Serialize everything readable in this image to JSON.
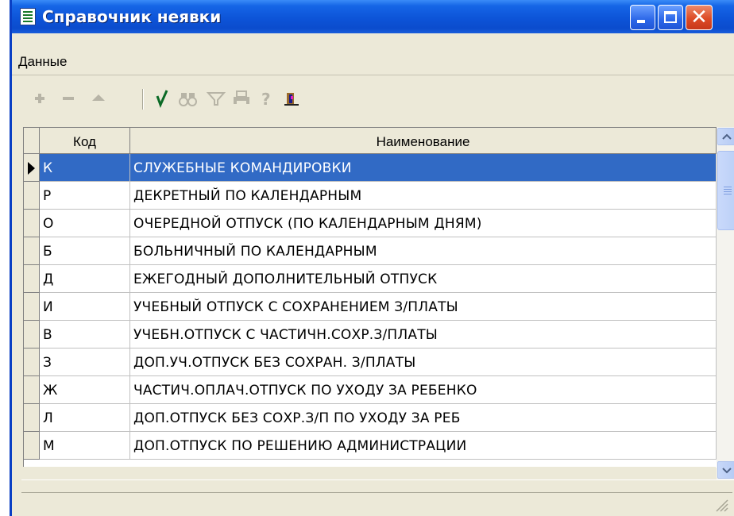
{
  "window": {
    "title": "Справочник неявки",
    "title_bar_color": "#0b4ccd",
    "controls": {
      "minimize_icon": "minimize-icon",
      "maximize_icon": "maximize-icon",
      "close_icon": "close-icon"
    }
  },
  "menu": {
    "items": [
      {
        "label": "Данные"
      }
    ]
  },
  "toolbar": {
    "buttons": [
      {
        "icon": "add-icon",
        "enabled": false
      },
      {
        "icon": "delete-icon",
        "enabled": false
      },
      {
        "icon": "move-up-icon",
        "enabled": false
      },
      {
        "icon": "check-icon",
        "enabled": true
      },
      {
        "icon": "find-icon",
        "enabled": false
      },
      {
        "icon": "filter-icon",
        "enabled": false
      },
      {
        "icon": "print-icon",
        "enabled": false
      },
      {
        "icon": "help-icon",
        "enabled": false
      },
      {
        "icon": "exit-icon",
        "enabled": true
      }
    ]
  },
  "grid": {
    "columns": [
      {
        "header": "Код"
      },
      {
        "header": "Наименование"
      }
    ],
    "selected_row": 0,
    "selection_color": "#316ac5",
    "rows": [
      {
        "code": "К",
        "name": "СЛУЖЕБНЫЕ КОМАНДИРОВКИ"
      },
      {
        "code": "Р",
        "name": "ДЕКРЕТНЫЙ ПО КАЛЕНДАРНЫМ"
      },
      {
        "code": "О",
        "name": "ОЧЕРЕДНОЙ ОТПУСК (ПО КАЛЕНДАРНЫМ ДНЯМ)"
      },
      {
        "code": "Б",
        "name": "БОЛЬНИЧНЫЙ ПО КАЛЕНДАРНЫМ"
      },
      {
        "code": "Д",
        "name": "ЕЖЕГОДНЫЙ ДОПОЛНИТЕЛЬНЫЙ ОТПУСК"
      },
      {
        "code": "И",
        "name": "УЧЕБНЫЙ ОТПУСК С СОХРАНЕНИЕМ З/ПЛАТЫ"
      },
      {
        "code": "В",
        "name": "УЧЕБН.ОТПУСК С ЧАСТИЧН.СОХР.З/ПЛАТЫ"
      },
      {
        "code": "З",
        "name": "ДОП.УЧ.ОТПУСК БЕЗ СОХРАН. З/ПЛАТЫ"
      },
      {
        "code": "Ж",
        "name": "ЧАСТИЧ.ОПЛАЧ.ОТПУСК ПО УХОДУ ЗА РЕБЕНКО"
      },
      {
        "code": "Л",
        "name": "ДОП.ОТПУСК БЕЗ СОХР.З/П ПО УХОДУ ЗА РЕБ"
      },
      {
        "code": "М",
        "name": "ДОП.ОТПУСК ПО РЕШЕНИЮ АДМИНИСТРАЦИИ"
      }
    ]
  }
}
